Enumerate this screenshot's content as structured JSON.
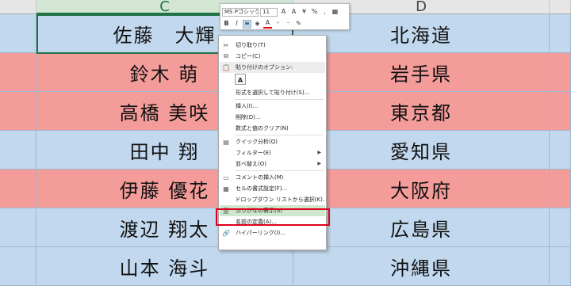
{
  "colors": {
    "blue_row": "#c2d8ee",
    "red_row": "#f49c9a",
    "highlight_box": "#e0001b",
    "selected_header": "#217346",
    "hot_item": "#cde8cf"
  },
  "columns": [
    {
      "label": "",
      "selected": false
    },
    {
      "label": "C",
      "selected": true
    },
    {
      "label": "D",
      "selected": false
    },
    {
      "label": "",
      "selected": false
    }
  ],
  "rows": [
    {
      "name": "佐藤　大輝",
      "pref": "北海道",
      "color": "blue"
    },
    {
      "name": "鈴木 萌",
      "pref": "岩手県",
      "color": "red"
    },
    {
      "name": "高橋 美咲",
      "pref": "東京都",
      "color": "red"
    },
    {
      "name": "田中 翔",
      "pref": "愛知県",
      "color": "blue"
    },
    {
      "name": "伊藤 優花",
      "pref": "大阪府",
      "color": "red"
    },
    {
      "name": "渡辺 翔太",
      "pref": "広島県",
      "color": "blue"
    },
    {
      "name": "山本 海斗",
      "pref": "沖縄県",
      "color": "blue"
    }
  ],
  "mini_toolbar": {
    "font_name": "MS Pゴシック",
    "font_size": "11",
    "row1_buttons": [
      {
        "name": "font-size-up-icon",
        "glyph": "A"
      },
      {
        "name": "font-size-down-icon",
        "glyph": "A"
      },
      {
        "name": "currency-format-icon",
        "glyph": "¥"
      },
      {
        "name": "percent-format-icon",
        "glyph": "%"
      },
      {
        "name": "comma-format-icon",
        "glyph": ","
      },
      {
        "name": "borders-icon",
        "glyph": "▦"
      }
    ],
    "row2_buttons": [
      {
        "name": "bold-icon",
        "glyph": "B",
        "active": false
      },
      {
        "name": "italic-icon",
        "glyph": "I",
        "active": false
      },
      {
        "name": "align-center-icon",
        "glyph": "≡",
        "active": true
      },
      {
        "name": "fill-color-icon",
        "glyph": "◈",
        "active": false
      },
      {
        "name": "font-color-icon",
        "glyph": "A",
        "active": false
      },
      {
        "name": "increase-decimal-icon",
        "glyph": "⁺",
        "active": false
      },
      {
        "name": "decrease-decimal-icon",
        "glyph": "⁻",
        "active": false
      },
      {
        "name": "format-painter-icon",
        "glyph": "✎",
        "active": false
      }
    ]
  },
  "context_menu": [
    {
      "type": "item",
      "name": "menu-cut",
      "icon": "scissors-icon",
      "glyph": "✂",
      "label": "切り取り(T)"
    },
    {
      "type": "item",
      "name": "menu-copy",
      "icon": "copy-icon",
      "glyph": "⧉",
      "label": "コピー(C)"
    },
    {
      "type": "header",
      "name": "menu-paste-options-header",
      "icon": "clipboard-icon",
      "glyph": "📋",
      "label": "貼り付けのオプション:"
    },
    {
      "type": "paste",
      "name": "paste-option-button",
      "glyph": "A"
    },
    {
      "type": "item",
      "name": "menu-paste-special",
      "icon": "",
      "glyph": "",
      "label": "形式を選択して貼り付け(S)..."
    },
    {
      "type": "sep"
    },
    {
      "type": "item",
      "name": "menu-insert",
      "icon": "",
      "glyph": "",
      "label": "挿入(I)..."
    },
    {
      "type": "item",
      "name": "menu-delete",
      "icon": "",
      "glyph": "",
      "label": "削除(D)..."
    },
    {
      "type": "item",
      "name": "menu-clear-contents",
      "icon": "",
      "glyph": "",
      "label": "数式と値のクリア(N)"
    },
    {
      "type": "sep"
    },
    {
      "type": "item",
      "name": "menu-quick-analysis",
      "icon": "quick-analysis-icon",
      "glyph": "▤",
      "label": "クイック分析(Q)"
    },
    {
      "type": "item",
      "name": "menu-filter",
      "icon": "",
      "glyph": "",
      "label": "フィルター(E)",
      "submenu": true
    },
    {
      "type": "item",
      "name": "menu-sort",
      "icon": "",
      "glyph": "",
      "label": "並べ替え(O)",
      "submenu": true
    },
    {
      "type": "sep"
    },
    {
      "type": "item",
      "name": "menu-insert-comment",
      "icon": "comment-icon",
      "glyph": "▭",
      "label": "コメントの挿入(M)"
    },
    {
      "type": "item",
      "name": "menu-format-cells",
      "icon": "format-cells-icon",
      "glyph": "▦",
      "label": "セルの書式設定(F)..."
    },
    {
      "type": "item",
      "name": "menu-pick-from-list",
      "icon": "",
      "glyph": "",
      "label": "ドロップダウン リストから選択(K)..."
    },
    {
      "type": "item",
      "name": "menu-phonetic",
      "icon": "phonetic-icon",
      "glyph": "亜",
      "label": "ふりがなの表示(S)",
      "hot": true
    },
    {
      "type": "item",
      "name": "menu-define-name",
      "icon": "",
      "glyph": "",
      "label": "名前の定義(A)..."
    },
    {
      "type": "item",
      "name": "menu-hyperlink",
      "icon": "hyperlink-icon",
      "glyph": "🔗",
      "label": "ハイパーリンク(I)..."
    }
  ]
}
